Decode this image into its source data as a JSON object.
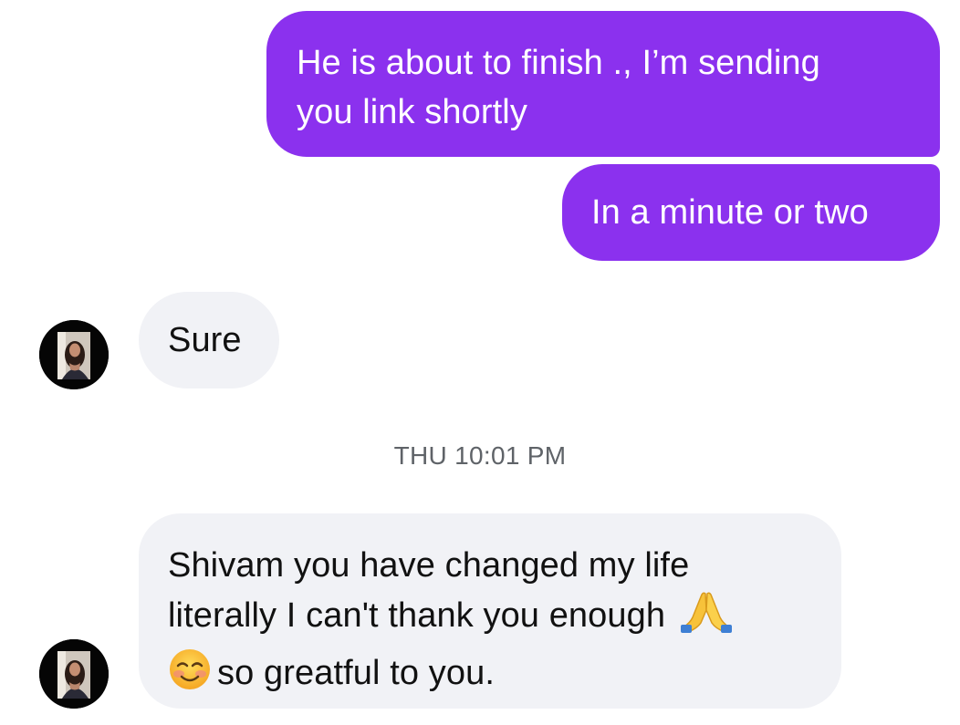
{
  "messages": [
    {
      "direction": "outgoing",
      "lines": [
        "He is about to finish ., I’m sending",
        "you link shortly"
      ]
    },
    {
      "direction": "outgoing",
      "text": "In a minute or two"
    },
    {
      "direction": "incoming",
      "text": "Sure"
    },
    {
      "direction": "incoming",
      "lines": [
        "Shivam you have changed my life",
        "literally I can't thank you enough",
        "so greatful to you."
      ],
      "emojis": [
        "folded-hands-icon",
        "smiling-face-icon"
      ]
    }
  ],
  "timestamp": "THU 10:01 PM",
  "colors": {
    "outgoing_bubble": "#8b31ee",
    "incoming_bubble": "#f1f2f6",
    "timestamp_text": "#5f6368"
  }
}
